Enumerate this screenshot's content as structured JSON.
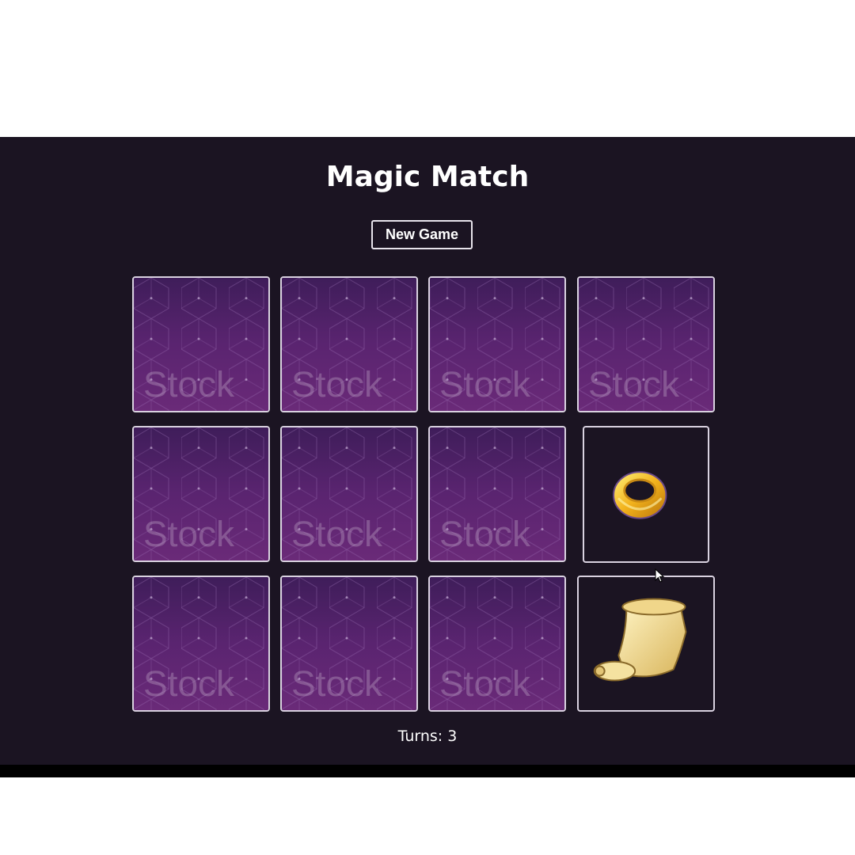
{
  "game": {
    "title": "Magic Match",
    "new_game_label": "New Game",
    "turns_label": "Turns:",
    "turns_value": "3"
  },
  "cards": [
    {
      "state": "face-down",
      "back_text": "Stock"
    },
    {
      "state": "face-down",
      "back_text": "Stock"
    },
    {
      "state": "face-down",
      "back_text": "Stock"
    },
    {
      "state": "face-down",
      "back_text": "Stock"
    },
    {
      "state": "face-down",
      "back_text": "Stock"
    },
    {
      "state": "face-down",
      "back_text": "Stock"
    },
    {
      "state": "face-down",
      "back_text": "Stock"
    },
    {
      "state": "face-up",
      "item": "ring-icon"
    },
    {
      "state": "face-down",
      "back_text": "Stock"
    },
    {
      "state": "face-down",
      "back_text": "Stock"
    },
    {
      "state": "face-down",
      "back_text": "Stock"
    },
    {
      "state": "face-up",
      "item": "scroll-icon"
    }
  ],
  "colors": {
    "background": "#1b1422",
    "card_back": "#5a2470",
    "card_border": "#d9d2e0",
    "text": "#ffffff"
  }
}
